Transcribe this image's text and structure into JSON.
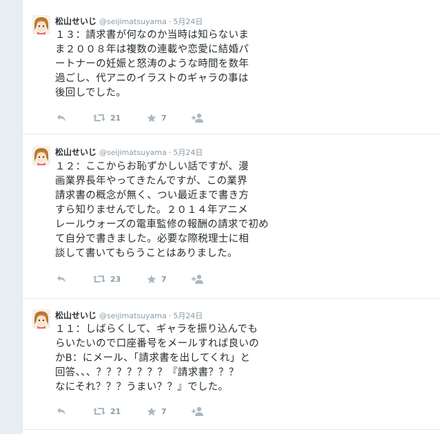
{
  "colors": {
    "background": "#e9eef3",
    "card": "#ffffff",
    "name": "#292f33",
    "meta": "#8899a6",
    "icon": "#aab8c2"
  },
  "tweets": [
    {
      "name": "松山せいじ",
      "handle": "@seijimatsuyama",
      "separator": "·",
      "time": "5月24日",
      "text": "１３：請求書が何なのか当時は知らないま\nま２００８年は複数の連載や恋愛に結婚パ\nートナーの妊娠と怒涛のような時間を数年\n過ごし、代アニのイラストのギャラの事は\n後回しでした。",
      "retweets": "21",
      "favorites": "7"
    },
    {
      "name": "松山せいじ",
      "handle": "@seijimatsuyama",
      "separator": "·",
      "time": "5月24日",
      "text": "１２：ここからお恥ずかしい話ですが、漫\n画業界長年やってきたんですが、この業界\n請求書の概念が無く、つい最近まで書き方\nすら知りませんでした。２０１４年アニメ\nレールウォーズの電車監修の報酬の請求で初め\nて自分で書きました。必要な際税理士に相\n談して書いてもらうことはありました。",
      "retweets": "23",
      "favorites": "7"
    },
    {
      "name": "松山せいじ",
      "handle": "@seijimatsuyama",
      "separator": "·",
      "time": "5月24日",
      "text": "１１：しばらくして、ギャラを振り込んでも\nらいたいので口座番号をメールすれば良いの\nかB：にメール、「請求書を出してくれ」と\n回答、、、？？？？？？？『請求書？？？\nなにそれ？？？うまい？？』でした。",
      "retweets": "21",
      "favorites": "7"
    }
  ]
}
